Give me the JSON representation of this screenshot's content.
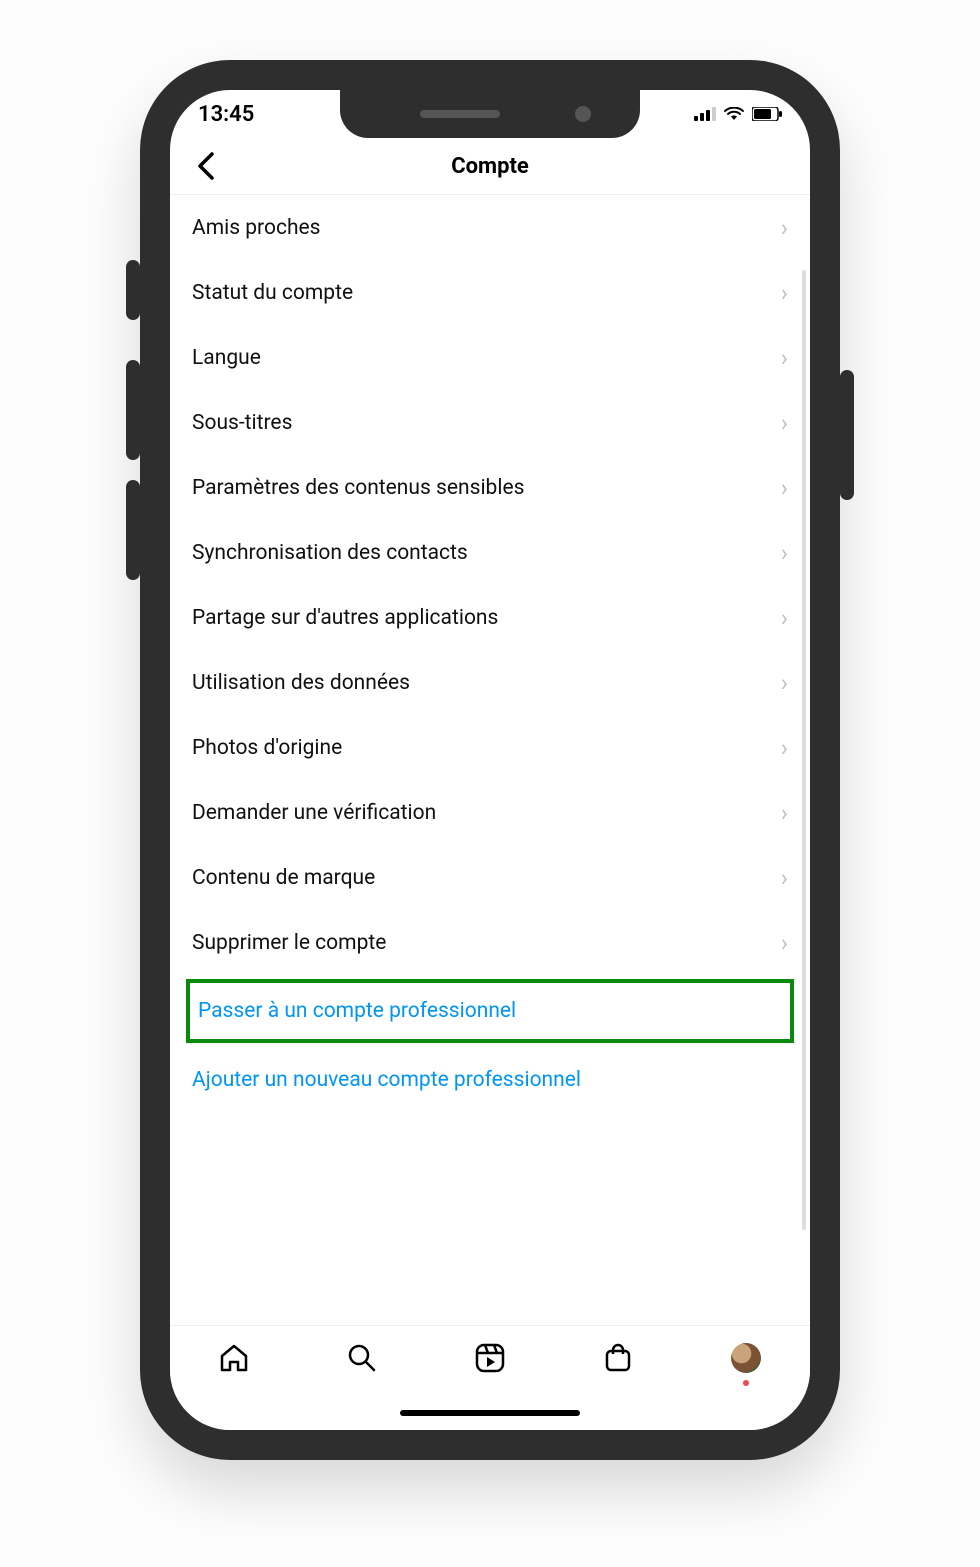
{
  "status": {
    "time": "13:45"
  },
  "header": {
    "title": "Compte"
  },
  "menu": [
    {
      "label": "Amis proches",
      "type": "nav"
    },
    {
      "label": "Statut du compte",
      "type": "nav"
    },
    {
      "label": "Langue",
      "type": "nav"
    },
    {
      "label": "Sous-titres",
      "type": "nav"
    },
    {
      "label": "Paramètres des contenus sensibles",
      "type": "nav"
    },
    {
      "label": "Synchronisation des contacts",
      "type": "nav"
    },
    {
      "label": "Partage sur d'autres applications",
      "type": "nav"
    },
    {
      "label": "Utilisation des données",
      "type": "nav"
    },
    {
      "label": "Photos d'origine",
      "type": "nav"
    },
    {
      "label": "Demander une vérification",
      "type": "nav"
    },
    {
      "label": "Contenu de marque",
      "type": "nav"
    },
    {
      "label": "Supprimer le compte",
      "type": "nav"
    },
    {
      "label": "Passer à un compte professionnel",
      "type": "link",
      "highlighted": true
    },
    {
      "label": "Ajouter un nouveau compte professionnel",
      "type": "link"
    }
  ],
  "colors": {
    "link": "#0095f6",
    "highlight_border": "#0a8a0a",
    "chevron": "#c0c0c0"
  }
}
